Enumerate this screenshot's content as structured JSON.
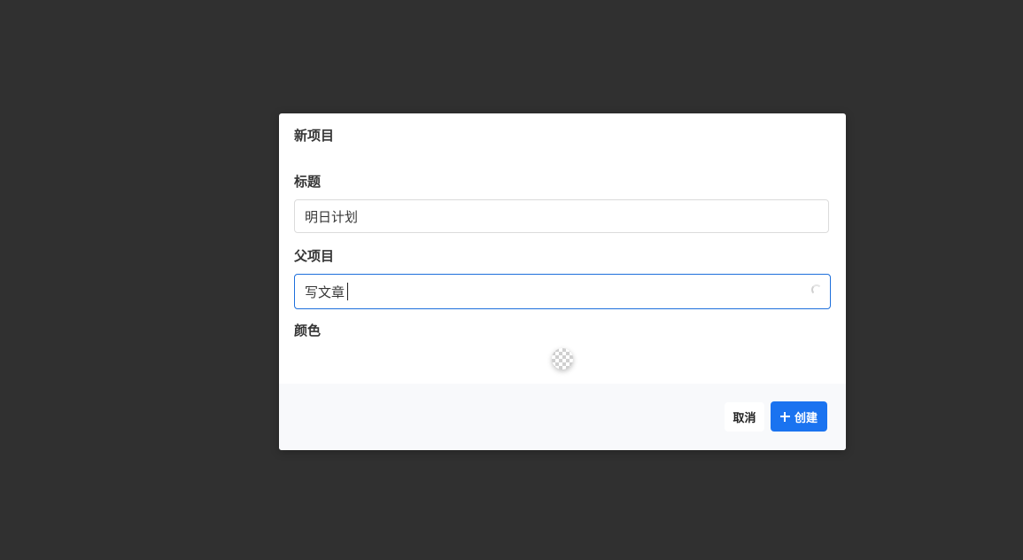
{
  "modal": {
    "title": "新项目",
    "fields": {
      "title_label": "标题",
      "title_value": "明日计划",
      "parent_label": "父项目",
      "parent_value": "写文章",
      "color_label": "颜色"
    },
    "footer": {
      "cancel_label": "取消",
      "create_label": "创建"
    }
  },
  "colors": {
    "overlay": "#303030",
    "primary": "#1a73f0",
    "focus_border": "#1d6fdc",
    "footer_bg": "#f8f9fb"
  },
  "icons": {
    "create": "plus-icon",
    "loading": "spinner-icon",
    "color": "transparent-checker-swatch"
  }
}
